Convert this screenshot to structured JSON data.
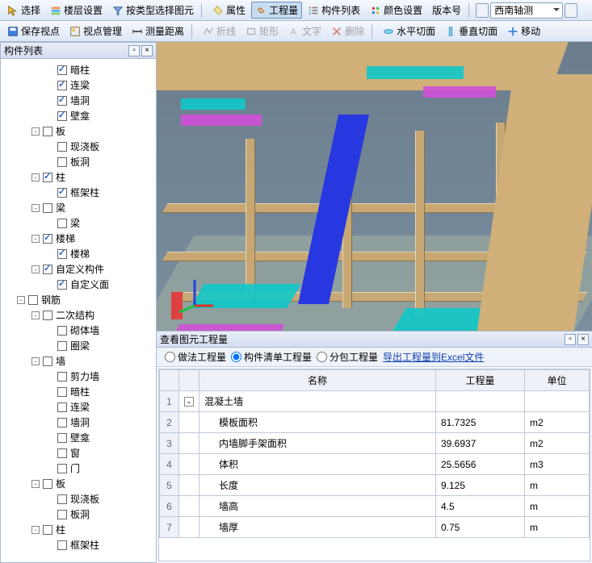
{
  "toolbar1": {
    "select": "选择",
    "floor_settings": "楼层设置",
    "select_by_type": "按类型选择图元",
    "props": "属性",
    "qty": "工程量",
    "comp_list": "构件列表",
    "color_set": "颜色设置",
    "version": "版本号",
    "view_dd": "西南轴测"
  },
  "toolbar2": {
    "save_view": "保存视点",
    "view_mgr": "视点管理",
    "measure": "测量距离",
    "polyline": "折线",
    "rect": "矩形",
    "text": "文字",
    "delete": "删除",
    "hcut": "水平切面",
    "vcut": "垂直切面",
    "move": "移动"
  },
  "left_panel": {
    "title": "构件列表"
  },
  "tree": [
    {
      "d": 3,
      "t": "",
      "cb": true,
      "chk": true,
      "label": "暗柱"
    },
    {
      "d": 3,
      "t": "",
      "cb": true,
      "chk": true,
      "label": "连梁"
    },
    {
      "d": 3,
      "t": "",
      "cb": true,
      "chk": true,
      "label": "墙洞"
    },
    {
      "d": 3,
      "t": "",
      "cb": true,
      "chk": true,
      "label": "壁龛"
    },
    {
      "d": 2,
      "t": "▾",
      "cb": true,
      "chk": false,
      "label": "板"
    },
    {
      "d": 3,
      "t": "",
      "cb": true,
      "chk": false,
      "label": "现浇板"
    },
    {
      "d": 3,
      "t": "",
      "cb": true,
      "chk": false,
      "label": "板洞"
    },
    {
      "d": 2,
      "t": "▾",
      "cb": true,
      "chk": true,
      "label": "柱"
    },
    {
      "d": 3,
      "t": "",
      "cb": true,
      "chk": true,
      "label": "框架柱"
    },
    {
      "d": 2,
      "t": "▾",
      "cb": true,
      "chk": false,
      "label": "梁"
    },
    {
      "d": 3,
      "t": "",
      "cb": true,
      "chk": false,
      "label": "梁"
    },
    {
      "d": 2,
      "t": "▾",
      "cb": true,
      "chk": true,
      "label": "楼梯"
    },
    {
      "d": 3,
      "t": "",
      "cb": true,
      "chk": true,
      "label": "楼梯"
    },
    {
      "d": 2,
      "t": "▾",
      "cb": true,
      "chk": true,
      "label": "自定义构件"
    },
    {
      "d": 3,
      "t": "",
      "cb": true,
      "chk": true,
      "label": "自定义面"
    },
    {
      "d": 1,
      "t": "▾",
      "cb": true,
      "chk": false,
      "label": "钢筋"
    },
    {
      "d": 2,
      "t": "▾",
      "cb": true,
      "chk": false,
      "label": "二次结构"
    },
    {
      "d": 3,
      "t": "",
      "cb": true,
      "chk": false,
      "label": "砌体墙"
    },
    {
      "d": 3,
      "t": "",
      "cb": true,
      "chk": false,
      "label": "圈梁"
    },
    {
      "d": 2,
      "t": "▾",
      "cb": true,
      "chk": false,
      "label": "墙"
    },
    {
      "d": 3,
      "t": "",
      "cb": true,
      "chk": false,
      "label": "剪力墙"
    },
    {
      "d": 3,
      "t": "",
      "cb": true,
      "chk": false,
      "label": "暗柱"
    },
    {
      "d": 3,
      "t": "",
      "cb": true,
      "chk": false,
      "label": "连梁"
    },
    {
      "d": 3,
      "t": "",
      "cb": true,
      "chk": false,
      "label": "墙洞"
    },
    {
      "d": 3,
      "t": "",
      "cb": true,
      "chk": false,
      "label": "壁龛"
    },
    {
      "d": 3,
      "t": "",
      "cb": true,
      "chk": false,
      "label": "窗"
    },
    {
      "d": 3,
      "t": "",
      "cb": true,
      "chk": false,
      "label": "门"
    },
    {
      "d": 2,
      "t": "▾",
      "cb": true,
      "chk": false,
      "label": "板"
    },
    {
      "d": 3,
      "t": "",
      "cb": true,
      "chk": false,
      "label": "现浇板"
    },
    {
      "d": 3,
      "t": "",
      "cb": true,
      "chk": false,
      "label": "板洞"
    },
    {
      "d": 2,
      "t": "▾",
      "cb": true,
      "chk": false,
      "label": "柱"
    },
    {
      "d": 3,
      "t": "",
      "cb": true,
      "chk": false,
      "label": "框架柱"
    }
  ],
  "bottom": {
    "title": "查看图元工程量",
    "opt1": "做法工程量",
    "opt2": "构件清单工程量",
    "opt3": "分包工程量",
    "export": "导出工程量到Excel文件",
    "headers": {
      "name": "名称",
      "qty": "工程量",
      "unit": "单位"
    },
    "group": "混凝土墙",
    "rows": [
      {
        "n": "2",
        "name": "模板面积",
        "qty": "81.7325",
        "unit": "m2"
      },
      {
        "n": "3",
        "name": "内墙脚手架面积",
        "qty": "39.6937",
        "unit": "m2"
      },
      {
        "n": "4",
        "name": "体积",
        "qty": "25.5656",
        "unit": "m3"
      },
      {
        "n": "5",
        "name": "长度",
        "qty": "9.125",
        "unit": "m"
      },
      {
        "n": "6",
        "name": "墙高",
        "qty": "4.5",
        "unit": "m"
      },
      {
        "n": "7",
        "name": "墙厚",
        "qty": "0.75",
        "unit": "m"
      }
    ]
  }
}
